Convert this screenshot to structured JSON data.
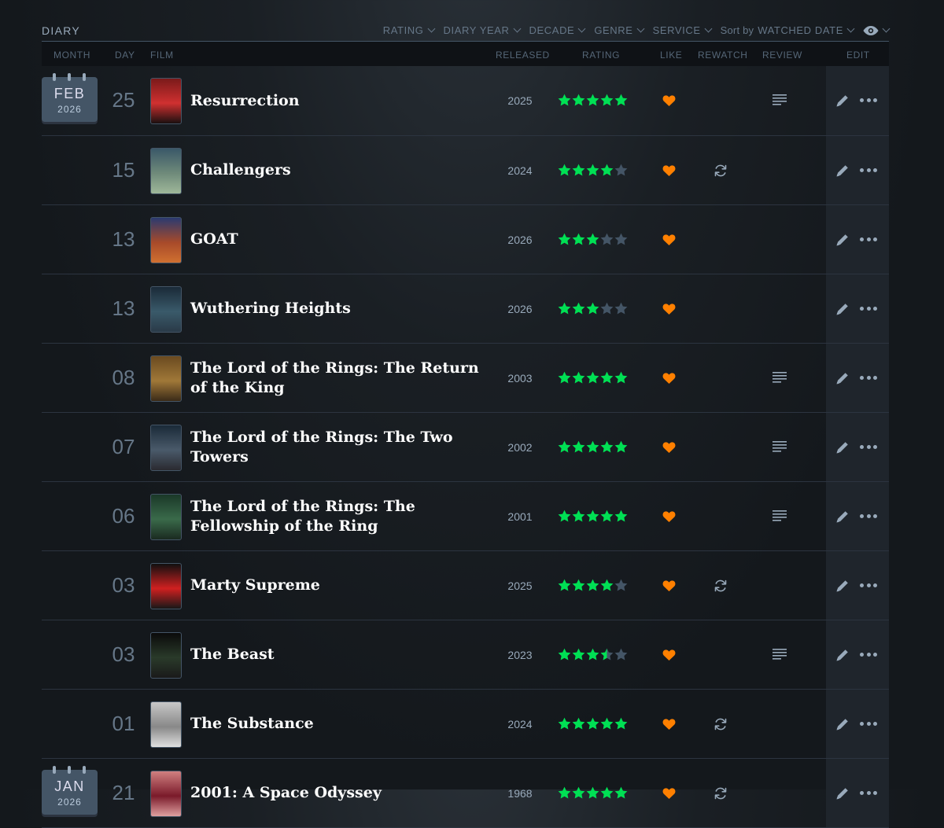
{
  "header": {
    "title": "DIARY",
    "filters": [
      "RATING",
      "DIARY YEAR",
      "DECADE",
      "GENRE",
      "SERVICE"
    ],
    "sort_label": "Sort by",
    "sort_value": "WATCHED DATE"
  },
  "columns": {
    "month": "MONTH",
    "day": "DAY",
    "film": "FILM",
    "released": "RELEASED",
    "rating": "RATING",
    "like": "LIKE",
    "rewatch": "REWATCH",
    "review": "REVIEW",
    "edit": "EDIT"
  },
  "colors": {
    "star_full": "#00e054",
    "star_empty": "#456",
    "like": "#ff8000",
    "background": "#14181c"
  },
  "entries": [
    {
      "month": "FEB",
      "year": "2026",
      "day": "25",
      "title": "Resurrection",
      "released": "2025",
      "rating": 5,
      "liked": true,
      "rewatch": false,
      "review": true,
      "poster": [
        "#7a1a1a",
        "#d03030",
        "#1a1010"
      ]
    },
    {
      "day": "15",
      "title": "Challengers",
      "released": "2024",
      "rating": 4,
      "liked": true,
      "rewatch": true,
      "review": false,
      "poster": [
        "#3a5868",
        "#6f8a7a",
        "#9fb89a"
      ]
    },
    {
      "day": "13",
      "title": "GOAT",
      "released": "2026",
      "rating": 3,
      "liked": true,
      "rewatch": false,
      "review": false,
      "poster": [
        "#2a3a70",
        "#a84a2a",
        "#d07030"
      ]
    },
    {
      "day": "13",
      "title": "Wuthering Heights",
      "released": "2026",
      "rating": 3,
      "liked": true,
      "rewatch": false,
      "review": false,
      "poster": [
        "#1a2a38",
        "#3a5a6a",
        "#2a3a48"
      ]
    },
    {
      "day": "08",
      "title": "The Lord of the Rings: The Return of the King",
      "released": "2003",
      "rating": 5,
      "liked": true,
      "rewatch": false,
      "review": true,
      "poster": [
        "#6a4a20",
        "#a07838",
        "#3a2a18"
      ]
    },
    {
      "day": "07",
      "title": "The Lord of the Rings: The Two Towers",
      "released": "2002",
      "rating": 5,
      "liked": true,
      "rewatch": false,
      "review": true,
      "poster": [
        "#1a2a38",
        "#4a5a6a",
        "#2a2a30"
      ]
    },
    {
      "day": "06",
      "title": "The Lord of the Rings: The Fellowship of the Ring",
      "released": "2001",
      "rating": 5,
      "liked": true,
      "rewatch": false,
      "review": true,
      "poster": [
        "#1a3828",
        "#3a6a4a",
        "#1a2a20"
      ]
    },
    {
      "day": "03",
      "title": "Marty Supreme",
      "released": "2025",
      "rating": 4,
      "liked": true,
      "rewatch": true,
      "review": false,
      "poster": [
        "#101010",
        "#d02020",
        "#181818"
      ]
    },
    {
      "day": "03",
      "title": "The Beast",
      "released": "2023",
      "rating": 3.5,
      "liked": true,
      "rewatch": false,
      "review": true,
      "poster": [
        "#0a0a0a",
        "#2a3a2a",
        "#1a1a1a"
      ]
    },
    {
      "day": "01",
      "title": "The Substance",
      "released": "2024",
      "rating": 5,
      "liked": true,
      "rewatch": true,
      "review": false,
      "poster": [
        "#c8c8c8",
        "#888888",
        "#e0e0e0"
      ]
    },
    {
      "month": "JAN",
      "year": "2026",
      "day": "21",
      "title": "2001: A Space Odyssey",
      "released": "1968",
      "rating": 5,
      "liked": true,
      "rewatch": true,
      "review": false,
      "poster": [
        "#d08080",
        "#7a1a2a",
        "#e0a0a0"
      ]
    }
  ]
}
